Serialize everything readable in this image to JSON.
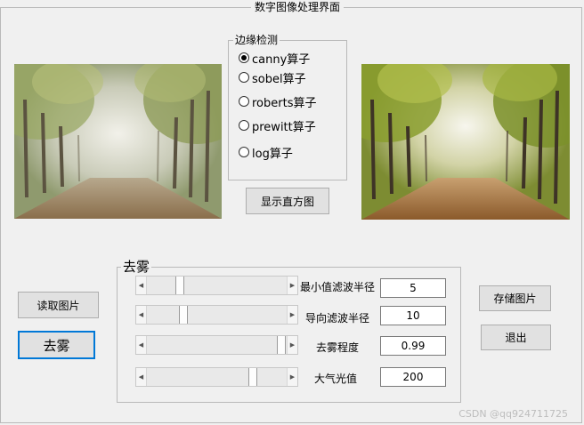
{
  "window": {
    "title": "数字图像处理界面"
  },
  "edge_detection": {
    "title": "边缘检测",
    "options": [
      {
        "label": "canny算子",
        "selected": true
      },
      {
        "label": "sobel算子",
        "selected": false
      },
      {
        "label": "roberts算子",
        "selected": false
      },
      {
        "label": "prewitt算子",
        "selected": false
      },
      {
        "label": "log算子",
        "selected": false
      }
    ]
  },
  "buttons": {
    "histogram": "显示直方图",
    "read_image": "读取图片",
    "defog": "去雾",
    "save_image": "存储图片",
    "exit": "退出"
  },
  "defog_panel": {
    "title": "去雾",
    "sliders": [
      {
        "label": "最小值滤波半径",
        "value": "5",
        "position": 0.25
      },
      {
        "label": "导向滤波半径",
        "value": "10",
        "position": 0.27
      },
      {
        "label": "去雾程度",
        "value": "0.99",
        "position": 0.99
      },
      {
        "label": "大气光值",
        "value": "200",
        "position": 0.82
      }
    ]
  },
  "images": {
    "original": "foggy-forest-road-photo",
    "processed": "dehazed-forest-road-photo"
  },
  "watermark": "CSDN @qq924711725"
}
